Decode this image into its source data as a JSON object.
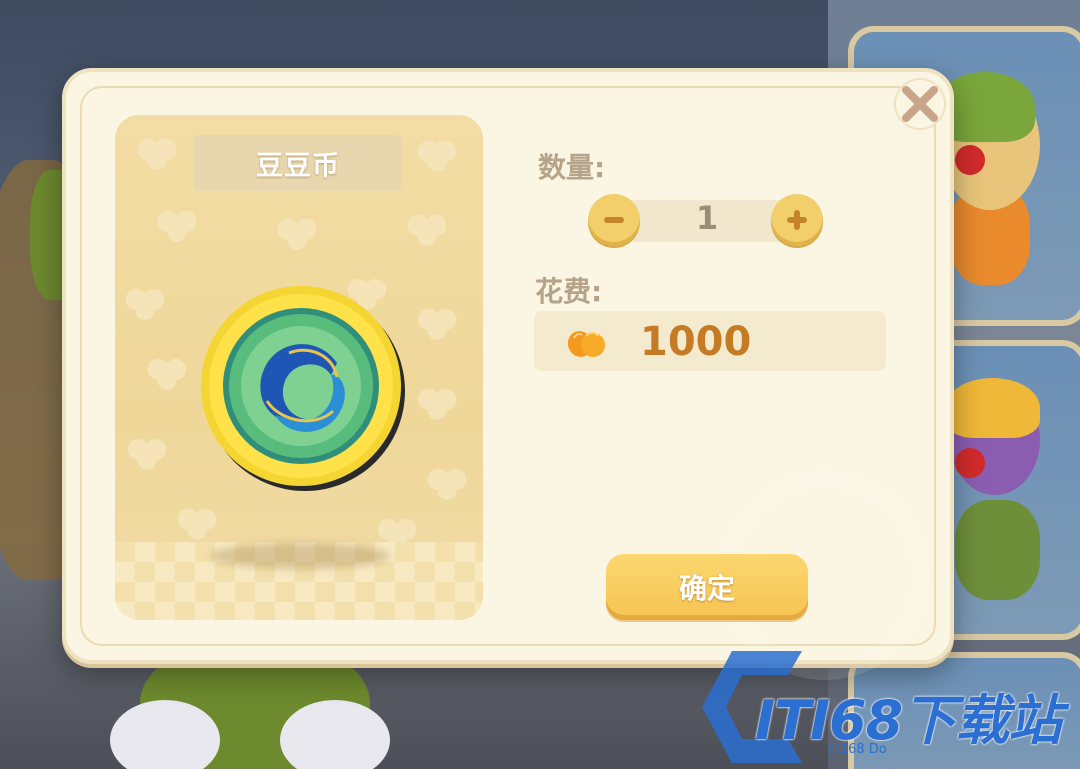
{
  "dialog": {
    "item_name": "豆豆币",
    "quantity_label": "数量:",
    "quantity_value": "1",
    "cost_label": "花费:",
    "cost_value": "1000",
    "cost_currency_icon": "tangerine-icon",
    "confirm_label": "确定",
    "close_icon": "close-icon",
    "item_icon": "coin-icon"
  },
  "watermark": {
    "logo_text": "ITI68下载站",
    "sub_text": "IT168 Do"
  },
  "colors": {
    "dialog_bg": "#fbf5e3",
    "accent_button": "#f6c452",
    "cost_text": "#c57b26",
    "label_text": "#b5a48a",
    "close_icon": "#c8a48a"
  }
}
